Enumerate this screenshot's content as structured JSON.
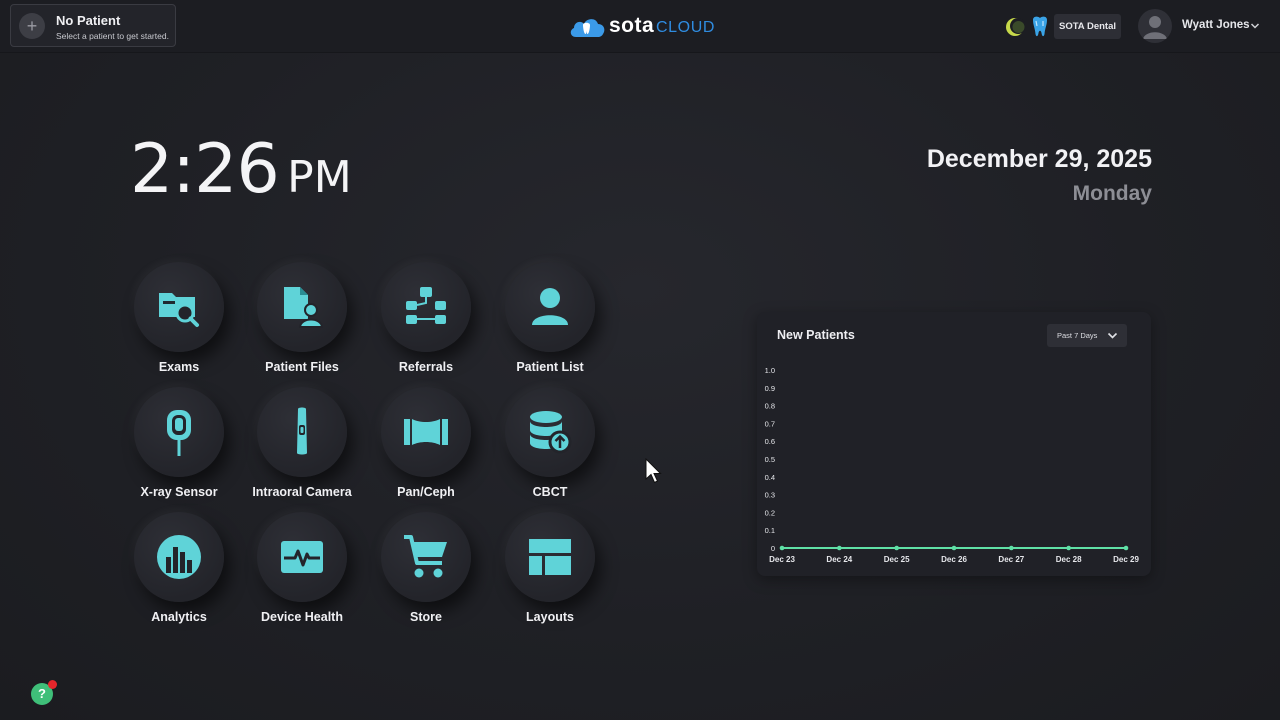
{
  "header": {
    "patient": {
      "title": "No Patient",
      "subtitle": "Select a patient to get started.",
      "add_icon": "plus-icon"
    },
    "logo": {
      "brand": "sota",
      "suffix": "CLOUD"
    },
    "practice_badge": "SOTA Dental",
    "user_name": "Wyatt Jones",
    "colors": {
      "accent": "#5fd3d8",
      "logo_blue": "#2f8ce0"
    }
  },
  "clock": {
    "time": "2:26",
    "ampm": "PM"
  },
  "date": {
    "full": "December 29, 2025",
    "weekday": "Monday"
  },
  "tiles": [
    {
      "label": "Exams",
      "icon": "folder-search-icon"
    },
    {
      "label": "Patient Files",
      "icon": "patient-file-icon"
    },
    {
      "label": "Referrals",
      "icon": "referral-network-icon"
    },
    {
      "label": "Patient List",
      "icon": "person-icon"
    },
    {
      "label": "X-ray Sensor",
      "icon": "xray-sensor-icon"
    },
    {
      "label": "Intraoral Camera",
      "icon": "intraoral-camera-icon"
    },
    {
      "label": "Pan/Ceph",
      "icon": "panoramic-icon"
    },
    {
      "label": "CBCT",
      "icon": "database-upload-icon"
    },
    {
      "label": "Analytics",
      "icon": "bar-chart-icon"
    },
    {
      "label": "Device Health",
      "icon": "heartbeat-monitor-icon"
    },
    {
      "label": "Store",
      "icon": "shopping-cart-icon"
    },
    {
      "label": "Layouts",
      "icon": "layout-grid-icon"
    }
  ],
  "chart_card": {
    "title": "New Patients",
    "range_label": "Past 7 Days"
  },
  "chart_data": {
    "type": "line",
    "title": "New Patients",
    "categories": [
      "Dec 23",
      "Dec 24",
      "Dec 25",
      "Dec 26",
      "Dec 27",
      "Dec 28",
      "Dec 29"
    ],
    "series": [
      {
        "values": [
          0,
          0,
          0,
          0,
          0,
          0,
          0
        ],
        "color": "#5fe0a6"
      }
    ],
    "yticks": [
      "1.0",
      "0.9",
      "0.8",
      "0.7",
      "0.6",
      "0.5",
      "0.4",
      "0.3",
      "0.2",
      "0.1",
      "0"
    ],
    "ylim": [
      0,
      1.0
    ],
    "grid": false
  }
}
